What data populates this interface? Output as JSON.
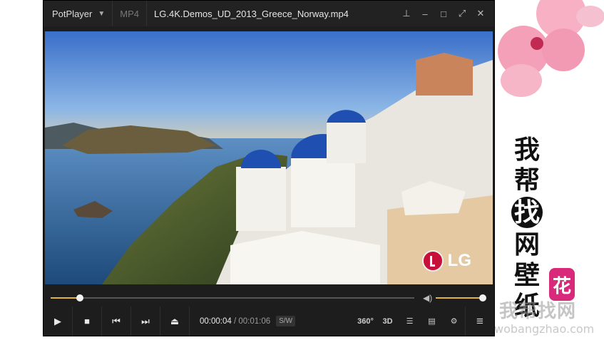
{
  "window": {
    "app_name": "PotPlayer",
    "format": "MP4",
    "file_title": "LG.4K.Demos_UD_2013_Greece_Norway.mp4"
  },
  "video": {
    "overlay_logo_text": "LG"
  },
  "playback": {
    "current_time": "00:00:04",
    "separator": "/",
    "duration": "00:01:06",
    "sw_badge": "S/W",
    "progress_fraction": 0.08,
    "volume_fraction": 1.0
  },
  "controls": {
    "left": [
      {
        "name": "play-icon",
        "glyph": "▶"
      },
      {
        "name": "stop-icon",
        "glyph": "■"
      },
      {
        "name": "previous-icon",
        "glyph": "⏮"
      },
      {
        "name": "next-icon",
        "glyph": "⏭"
      },
      {
        "name": "eject-icon",
        "glyph": "⏏"
      }
    ],
    "right": {
      "vr360_label": "360°",
      "label_3d": "3D",
      "playlist_glyph": "☰",
      "chapters_glyph": "▤",
      "settings_glyph": "⚙",
      "menu_glyph": "≡"
    }
  },
  "background": {
    "vertical_text": [
      "我",
      "帮",
      "找",
      "网",
      "壁",
      "纸"
    ],
    "seal_text": "花",
    "watermark_logo": "我帮找网",
    "watermark_url": "wobangzhao.com"
  },
  "colors": {
    "accent": "#e0b33a",
    "player_bg": "#1d1d1d",
    "seal": "#d8297a"
  }
}
